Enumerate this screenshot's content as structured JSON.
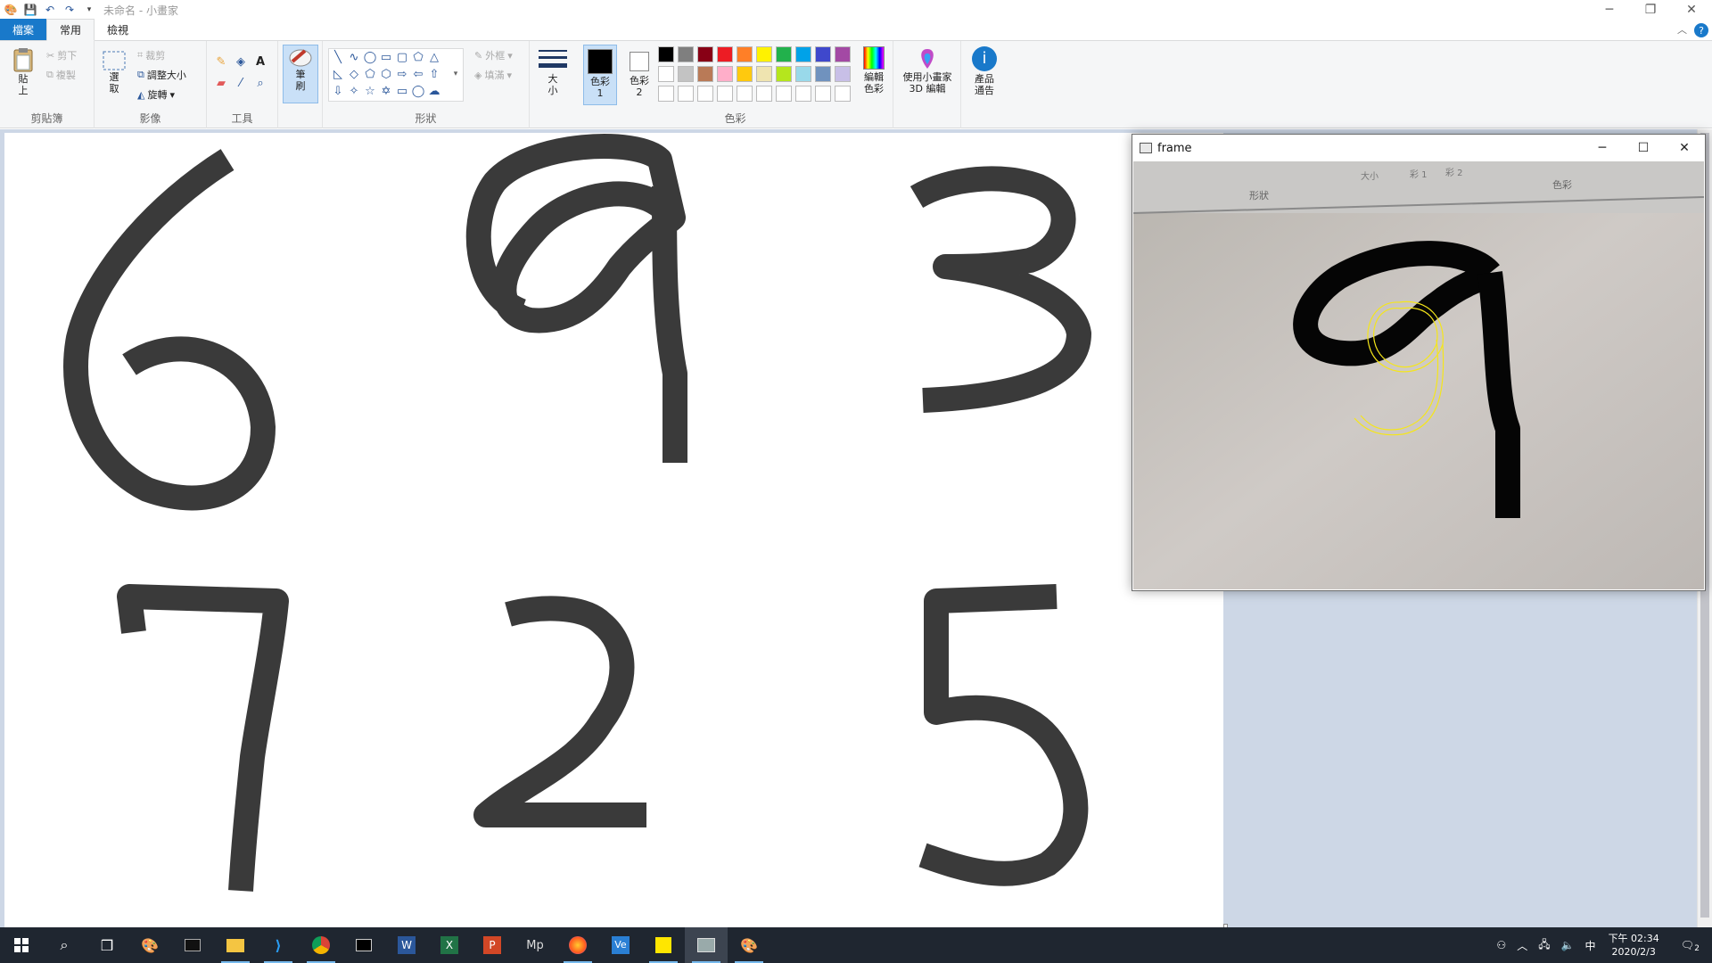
{
  "window": {
    "title": "未命名 - 小畫家",
    "controls": [
      "minimize",
      "restore",
      "close"
    ]
  },
  "tabs": [
    {
      "label": "檔案"
    },
    {
      "label": "常用"
    },
    {
      "label": "檢視"
    }
  ],
  "ribbon": {
    "clipboard": {
      "label": "剪貼簿",
      "paste": "貼上",
      "cut": "剪下",
      "copy": "複製"
    },
    "image": {
      "label": "影像",
      "select": "選取",
      "crop": "裁剪",
      "resize": "調整大小",
      "rotate": "旋轉"
    },
    "tools": {
      "label": "工具"
    },
    "brushes": {
      "label": "筆刷"
    },
    "shapes": {
      "label": "形狀",
      "outline": "外框",
      "fill": "填滿"
    },
    "size": {
      "label": "大小"
    },
    "colors": {
      "label": "色彩",
      "color1": "色彩 1",
      "color2": "色彩 2",
      "edit": "編輯色彩",
      "color1_value": "#000000",
      "color2_value": "#ffffff",
      "palette_row1": [
        "#000000",
        "#7f7f7f",
        "#880015",
        "#ed1c24",
        "#ff7f27",
        "#fff200",
        "#22b14c",
        "#00a2e8",
        "#3f48cc",
        "#a349a4"
      ],
      "palette_row2": [
        "#ffffff",
        "#c3c3c3",
        "#b97a57",
        "#ffaec9",
        "#ffc90e",
        "#efe4b0",
        "#b5e61d",
        "#99d9ea",
        "#7092be",
        "#c8bfe7"
      ],
      "palette_row3": [
        "#ffffff",
        "#ffffff",
        "#ffffff",
        "#ffffff",
        "#ffffff",
        "#ffffff",
        "#ffffff",
        "#ffffff",
        "#ffffff",
        "#ffffff"
      ]
    },
    "paint3d": {
      "label": "使用小畫家 3D 編輯"
    },
    "product_alert": {
      "label": "產品通告"
    }
  },
  "canvas": {
    "digits": [
      "6",
      "9",
      "3",
      "7",
      "2",
      "5"
    ]
  },
  "frame_window": {
    "title": "frame",
    "camera_toolbar_labels": [
      "形狀",
      "色彩",
      "大小",
      "彩 1",
      "彩 2"
    ],
    "drawn_digit": "9",
    "overlay_digit": "9"
  },
  "taskbar": {
    "apps": [
      "windows-start",
      "search",
      "task-view",
      "paint",
      "terminal",
      "file-explorer",
      "vscode",
      "chrome",
      "cmd",
      "word",
      "excel",
      "powerpoint",
      "mp",
      "firefox",
      "ve",
      "sticky-notes",
      "frame",
      "paint-active"
    ],
    "tray": {
      "time": "下午 02:34",
      "date": "2020/2/3",
      "ime": "中",
      "notifications": "2"
    }
  }
}
